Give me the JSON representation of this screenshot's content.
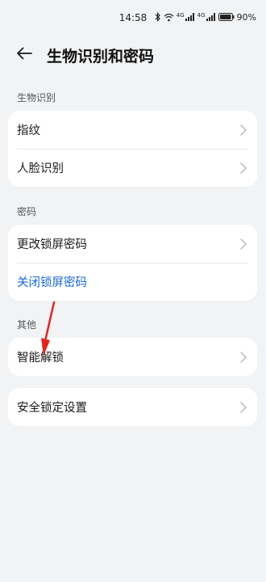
{
  "status_bar": {
    "time": "14:58",
    "network_1": "4G",
    "network_2": "4G",
    "battery": "90%"
  },
  "header": {
    "title": "生物识别和密码"
  },
  "sections": {
    "biometrics": {
      "label": "生物识别",
      "items": [
        {
          "label": "指纹"
        },
        {
          "label": "人脸识别"
        }
      ]
    },
    "password": {
      "label": "密码",
      "items": [
        {
          "label": "更改锁屏密码"
        },
        {
          "label": "关闭锁屏密码"
        }
      ]
    },
    "other": {
      "label": "其他",
      "items": [
        {
          "label": "智能解锁"
        }
      ]
    },
    "security": {
      "items": [
        {
          "label": "安全锁定设置"
        }
      ]
    }
  },
  "colors": {
    "background": "#f1f3f5",
    "card": "#ffffff",
    "link": "#1868d4",
    "annotation": "#e8221b"
  }
}
